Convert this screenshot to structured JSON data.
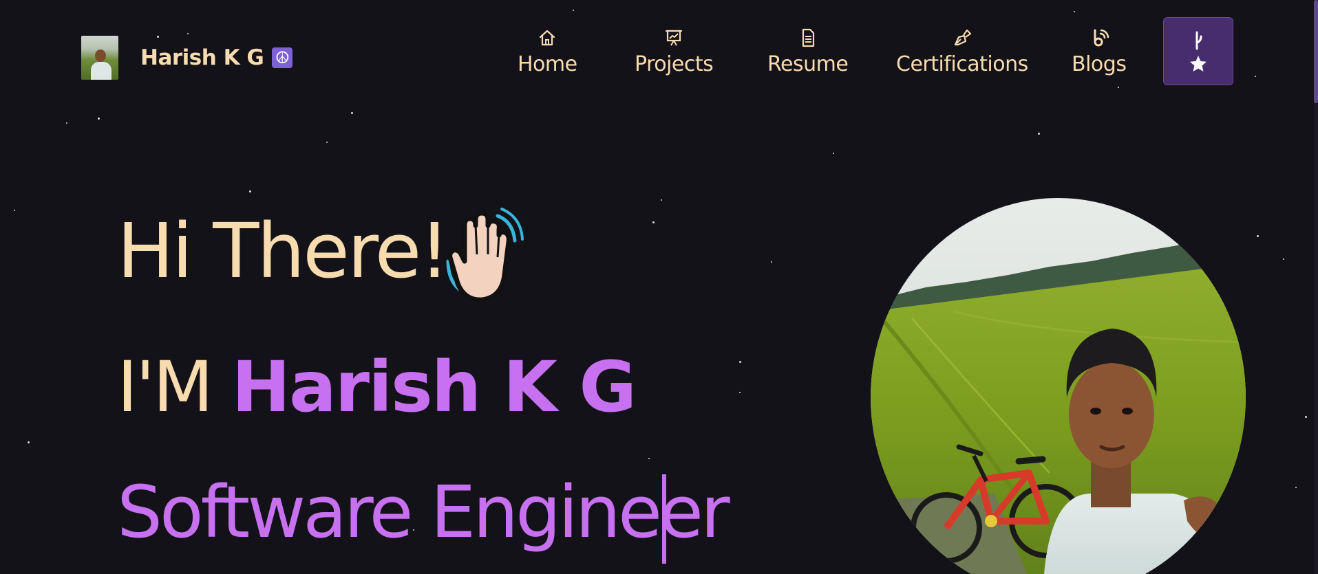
{
  "brand": {
    "name": "Harish K G",
    "badge_icon": "peace-sign-icon",
    "badge_symbol": "☮"
  },
  "nav": {
    "items": [
      {
        "label": "Home",
        "icon": "home-icon"
      },
      {
        "label": "Projects",
        "icon": "presentation-chart-icon"
      },
      {
        "label": "Resume",
        "icon": "document-icon"
      },
      {
        "label": "Certifications",
        "icon": "pen-nib-icon"
      },
      {
        "label": "Blogs",
        "icon": "blogger-icon"
      }
    ],
    "github_button": {
      "icons": [
        "git-fork-icon",
        "star-icon"
      ]
    }
  },
  "hero": {
    "greeting": "Hi There!",
    "wave_icon": "waving-hand-icon",
    "intro_prefix": "I'M",
    "name": "Harish K G",
    "role": "Software Engineer"
  },
  "colors": {
    "background": "#141219",
    "cream_text": "#f7dcb0",
    "accent_purple": "#c770f0",
    "github_button_bg": "#472c6e",
    "badge_purple": "#7d62d6"
  }
}
